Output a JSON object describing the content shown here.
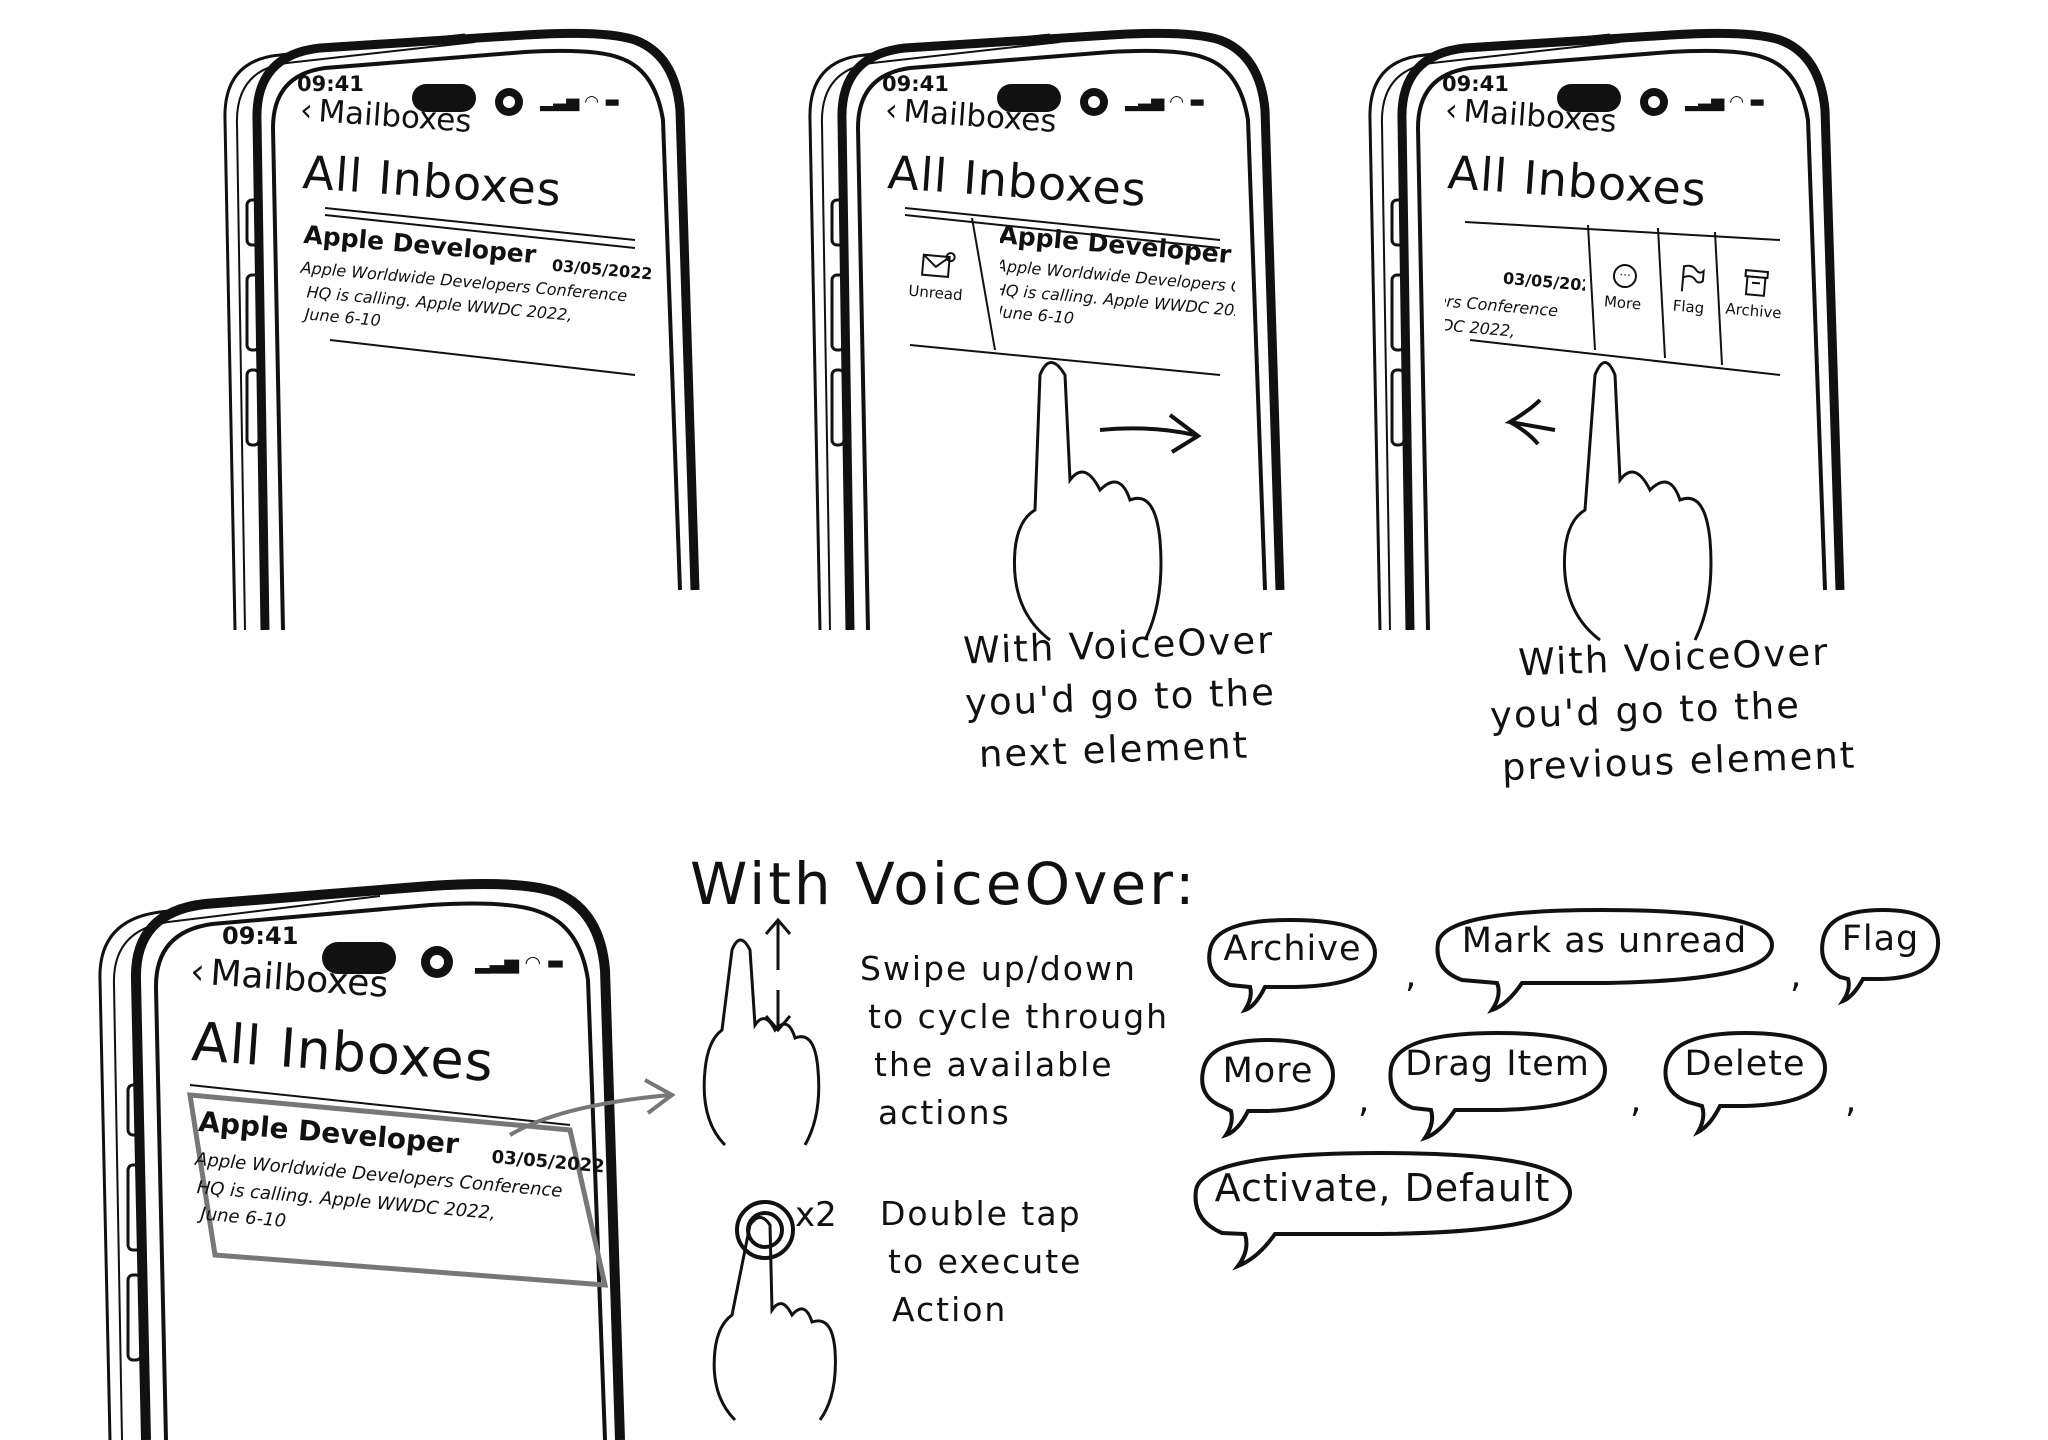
{
  "phone": {
    "time": "09:41",
    "back_label": "Mailboxes",
    "title": "All Inboxes",
    "mail": {
      "sender": "Apple Developer",
      "date": "03/05/2022",
      "subject": "Apple Worldwide Developers Conference",
      "preview1": "HQ is calling. Apple WWDC 2022,",
      "preview2": "June 6-10"
    }
  },
  "swipe_right_actions": [
    {
      "label": "Unread",
      "icon": "envelope-icon"
    }
  ],
  "swipe_left_actions": [
    {
      "label": "More",
      "icon": "ellipsis-circle-icon"
    },
    {
      "label": "Flag",
      "icon": "flag-icon"
    },
    {
      "label": "Archive",
      "icon": "archive-box-icon"
    }
  ],
  "captions": {
    "next": [
      "With VoiceOver",
      "you'd go to the",
      "next element"
    ],
    "previous": [
      "With VoiceOver",
      "you'd go to the",
      "previous element"
    ]
  },
  "voiceover": {
    "heading": "With VoiceOver:",
    "swipe_lines": [
      "Swipe up/down",
      "to cycle through",
      "the available",
      "actions"
    ],
    "tap_count": "x2",
    "tap_lines": [
      "Double tap",
      "to execute",
      "Action"
    ]
  },
  "spoken_actions": [
    "Archive",
    "Mark as unread",
    "Flag",
    "More",
    "Drag Item",
    "Delete",
    "Activate, Default"
  ],
  "comma": ","
}
